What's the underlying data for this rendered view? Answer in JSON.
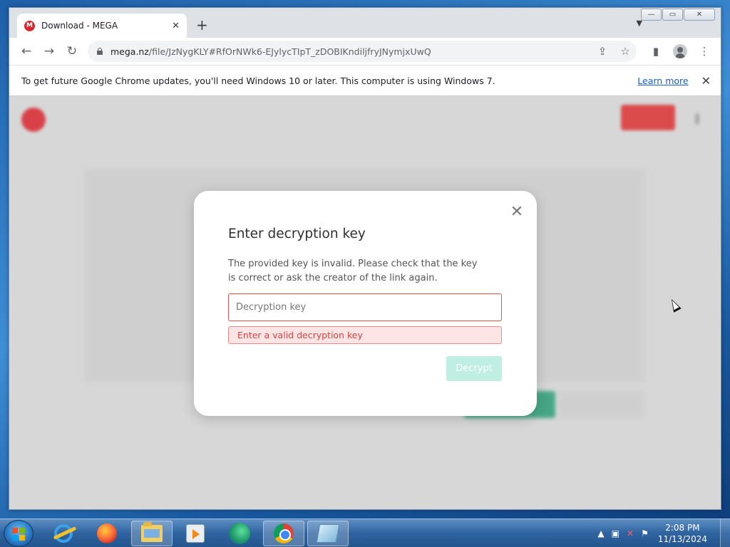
{
  "browser": {
    "tab_title": "Download - MEGA",
    "tab_favicon_letter": "M",
    "url_host": "mega.nz",
    "url_path": "/file/JzNygKLY#RfOrNWk6-EJylycTIpT_zDOBIKndiljfryJNymjxUwQ",
    "window_controls": {
      "minimize": "—",
      "maximize": "▭",
      "close": "✕"
    }
  },
  "infobar": {
    "message": "To get future Google Chrome updates, you'll need Windows 10 or later. This computer is using Windows 7.",
    "link": "Learn more"
  },
  "modal": {
    "title": "Enter decryption key",
    "description": "The provided key is invalid. Please check that the key is correct or ask the creator of the link again.",
    "input_placeholder": "Decryption key",
    "input_value": "",
    "error": "Enter a valid decryption key",
    "button": "Decrypt"
  },
  "taskbar": {
    "apps": [
      {
        "name": "internet-explorer-icon",
        "active": false
      },
      {
        "name": "firefox-icon",
        "active": false
      },
      {
        "name": "file-explorer-icon",
        "active": true
      },
      {
        "name": "media-player-icon",
        "active": false
      },
      {
        "name": "edge-icon",
        "active": false
      },
      {
        "name": "chrome-icon",
        "active": true
      },
      {
        "name": "app-icon",
        "active": true
      }
    ],
    "clock_time": "2:08 PM",
    "clock_date": "11/13/2024"
  },
  "colors": {
    "mega_red": "#d9272e",
    "error_red": "#d64545",
    "decrypt_disabled": "#bfeee2",
    "link_blue": "#1a5ec9"
  }
}
